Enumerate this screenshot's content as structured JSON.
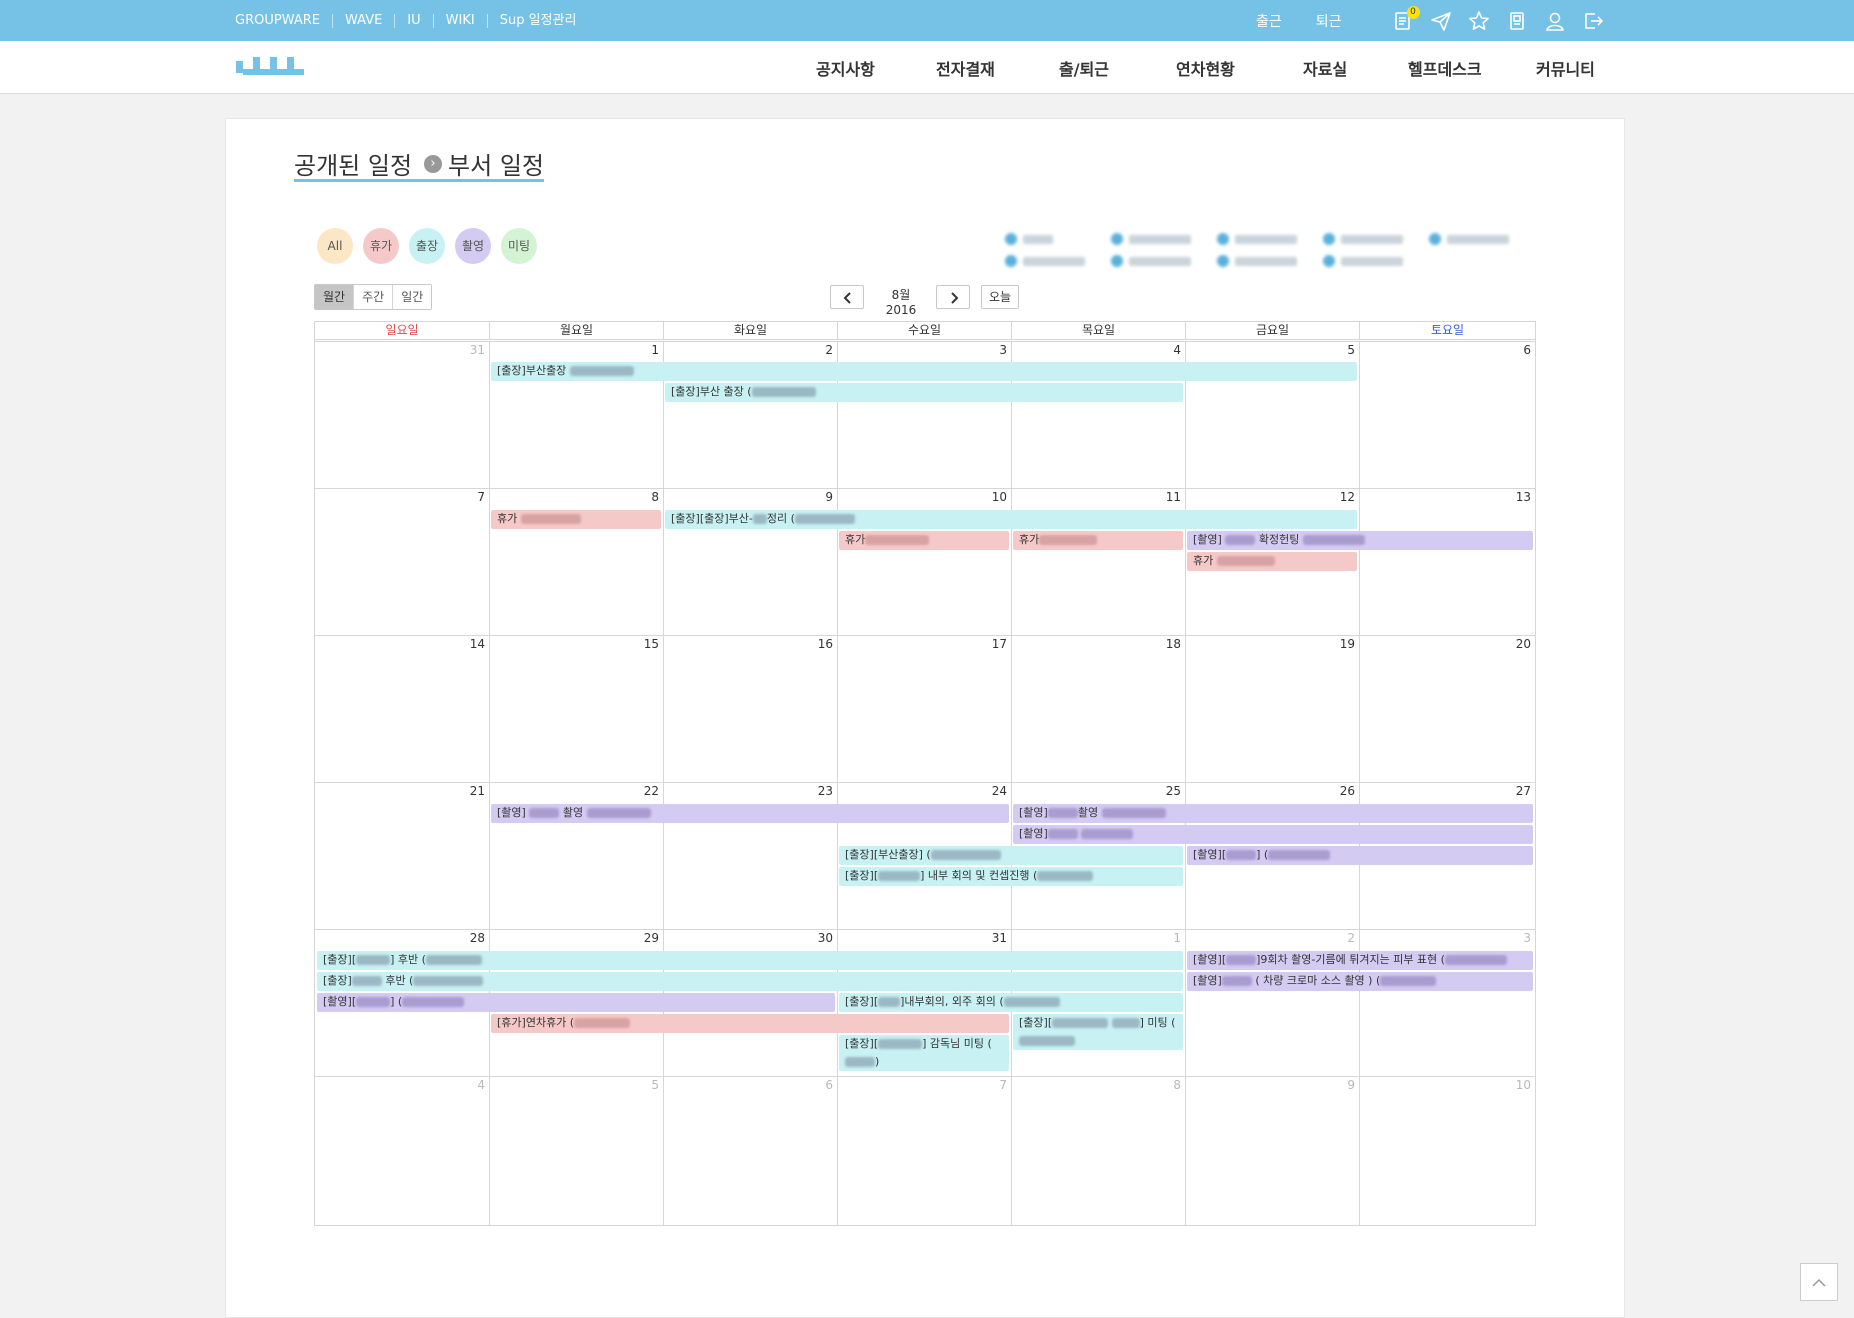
{
  "topbar": {
    "links": [
      "GROUPWARE",
      "WAVE",
      "IU",
      "WIKI",
      "Sup 일정관리"
    ],
    "checkin_label": "출근",
    "checkout_label": "퇴근",
    "notification_count": "0",
    "icons": [
      "notepad-icon",
      "send-icon",
      "star-icon",
      "book-icon",
      "user-icon",
      "logout-icon"
    ]
  },
  "nav": {
    "items": [
      "공지사항",
      "전자결재",
      "출/퇴근",
      "연차현황",
      "자료실",
      "헬프데스크",
      "커뮤니티"
    ]
  },
  "page": {
    "title_part1": "공개된 일정",
    "title_part2": "부서 일정"
  },
  "filters": [
    {
      "label": "All",
      "color": "#fbe7c6"
    },
    {
      "label": "휴가",
      "color": "#f6c9c9"
    },
    {
      "label": "출장",
      "color": "#c8f1f3"
    },
    {
      "label": "촬영",
      "color": "#d4cbf2"
    },
    {
      "label": "미팅",
      "color": "#d3f3d3"
    }
  ],
  "calendar": {
    "view_buttons": [
      "월간",
      "주간",
      "일간"
    ],
    "month_label": "8월 2016",
    "today_label": "오늘",
    "weekdays": [
      "일요일",
      "월요일",
      "화요일",
      "수요일",
      "목요일",
      "금요일",
      "토요일"
    ],
    "weekday_colors": {
      "sun": "#e14a4a",
      "sat": "#3a5bd9"
    },
    "days": [
      "31",
      "1",
      "2",
      "3",
      "4",
      "5",
      "6",
      "7",
      "8",
      "9",
      "10",
      "11",
      "12",
      "13",
      "14",
      "15",
      "16",
      "17",
      "18",
      "19",
      "20",
      "21",
      "22",
      "23",
      "24",
      "25",
      "26",
      "27",
      "28",
      "29",
      "30",
      "31",
      "1",
      "2",
      "3",
      "4",
      "5",
      "6",
      "7",
      "8",
      "9",
      "10"
    ],
    "events": [
      {
        "text": "[출장]부산출장"
      },
      {
        "text": "[출장]부산 출장 ("
      },
      {
        "text": "휴가"
      },
      {
        "text": "[출장][출장]부산-"
      },
      {
        "text": "정리 ("
      },
      {
        "text": "휴가"
      },
      {
        "text": "휴가"
      },
      {
        "text": "[촬영]"
      },
      {
        "text": "확정헌팅"
      },
      {
        "text": "휴가"
      },
      {
        "text": "[촬영]"
      },
      {
        "text": "촬영"
      },
      {
        "text": "[촬영]"
      },
      {
        "text": "촬영"
      },
      {
        "text": "[촬영]"
      },
      {
        "text": "[출장][부산출장] ("
      },
      {
        "text": "[촬영]["
      },
      {
        "text": "] ("
      },
      {
        "text": "[출장]["
      },
      {
        "text": "] 내부 회의 및 컨셉진행 ("
      },
      {
        "text": "[출장]["
      },
      {
        "text": "] 후반 ("
      },
      {
        "text": "[출장]"
      },
      {
        "text": " 후반 ("
      },
      {
        "text": "[촬영]["
      },
      {
        "text": "] ("
      },
      {
        "text": "[출장]["
      },
      {
        "text": "]내부회의, 외주 회의 ("
      },
      {
        "text": "[휴가]연차휴가 ("
      },
      {
        "text": "[출장]["
      },
      {
        "text": "] 미팅 ("
      },
      {
        "text": "[출장]["
      },
      {
        "text": "] 감독님 미팅 ("
      },
      {
        "text": "[촬영]["
      },
      {
        "text": "]9회차 촬영-기름에 튀겨지는 피부 표현 ("
      },
      {
        "text": "[촬영]"
      },
      {
        "text": " ( 차량 크로마 소스 촬영 ) ("
      },
      {
        "text": ")"
      }
    ]
  }
}
